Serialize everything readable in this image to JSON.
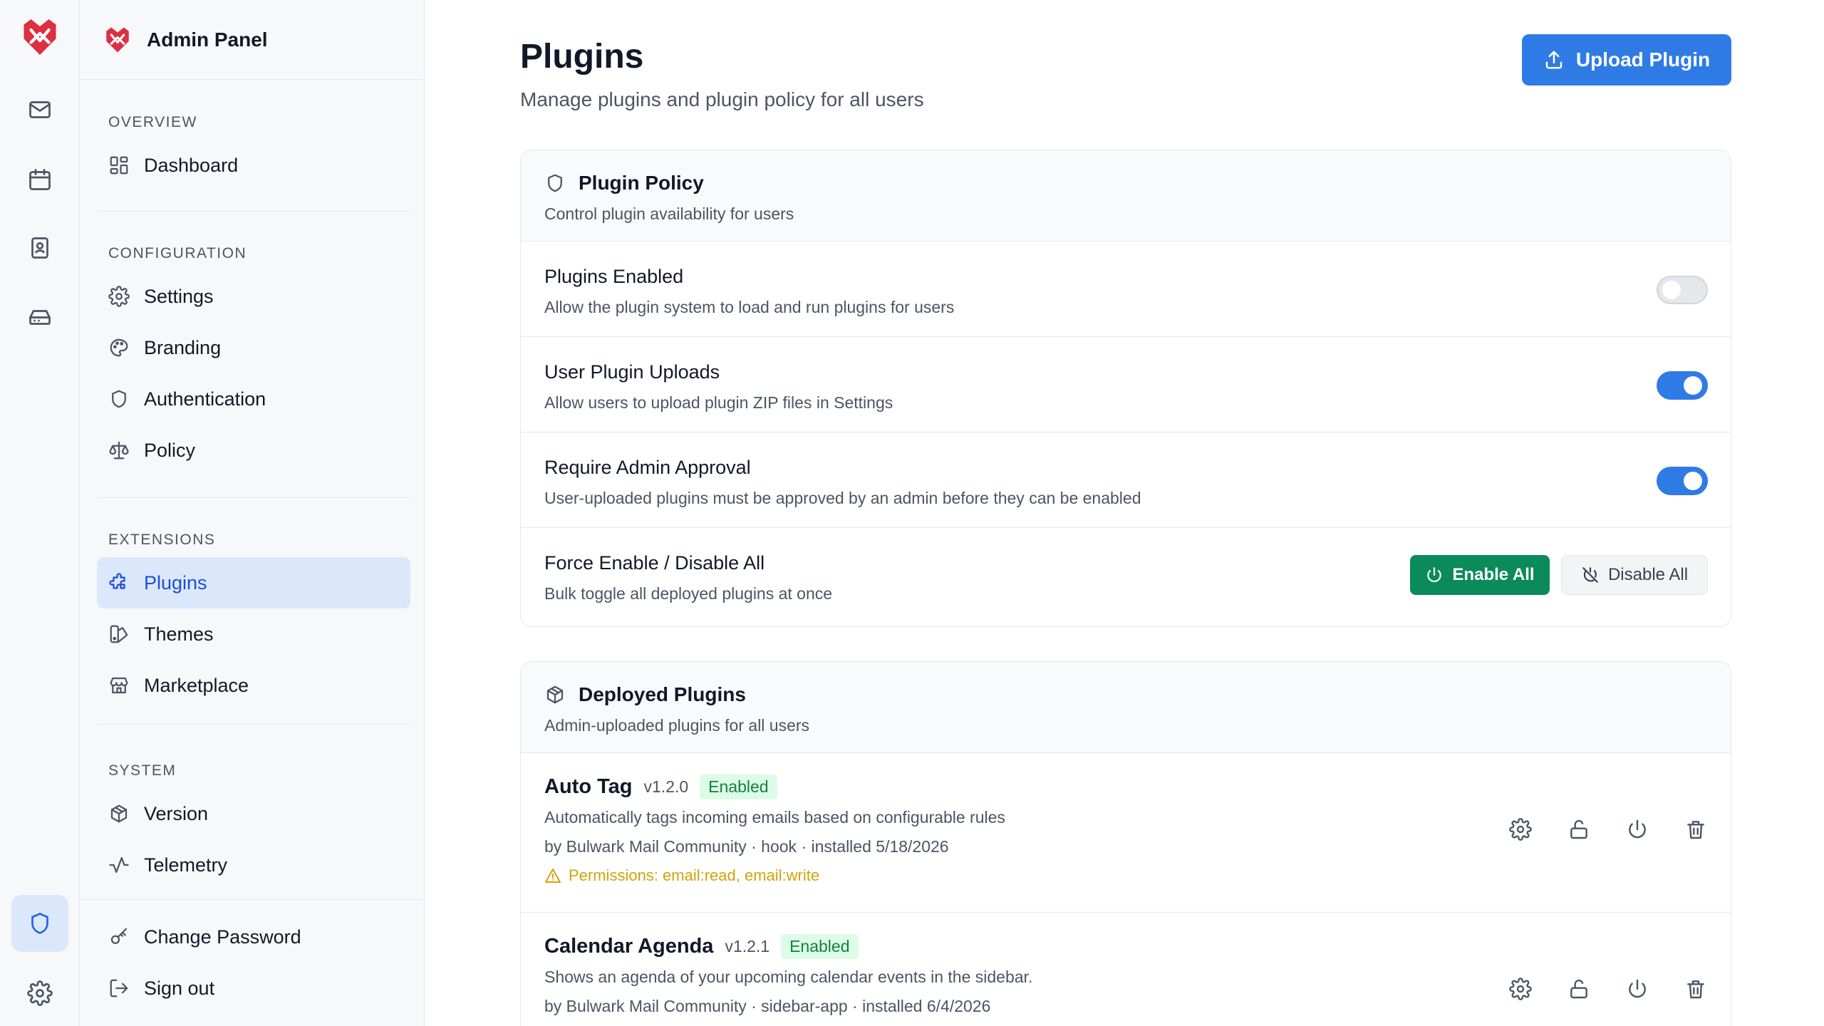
{
  "colors": {
    "accent": "#2f7be6",
    "success": "#0b8a5c",
    "warning": "#d4a20a",
    "active_bg": "#dbe7fb"
  },
  "rail": {
    "items": [
      {
        "icon": "mail-icon"
      },
      {
        "icon": "calendar-icon"
      },
      {
        "icon": "contacts-icon"
      },
      {
        "icon": "drive-icon"
      }
    ],
    "bottom": [
      {
        "icon": "shield-icon",
        "active": true
      },
      {
        "icon": "gear-icon"
      }
    ]
  },
  "sidebar": {
    "title": "Admin Panel",
    "sections": [
      {
        "label": "OVERVIEW",
        "items": [
          {
            "label": "Dashboard",
            "icon": "dashboard-icon"
          }
        ]
      },
      {
        "label": "CONFIGURATION",
        "items": [
          {
            "label": "Settings",
            "icon": "gear-icon"
          },
          {
            "label": "Branding",
            "icon": "palette-icon"
          },
          {
            "label": "Authentication",
            "icon": "shield-icon"
          },
          {
            "label": "Policy",
            "icon": "scale-icon"
          }
        ]
      },
      {
        "label": "EXTENSIONS",
        "items": [
          {
            "label": "Plugins",
            "icon": "puzzle-icon",
            "active": true
          },
          {
            "label": "Themes",
            "icon": "swatch-icon"
          },
          {
            "label": "Marketplace",
            "icon": "store-icon"
          }
        ]
      },
      {
        "label": "SYSTEM",
        "items": [
          {
            "label": "Version",
            "icon": "package-icon"
          },
          {
            "label": "Telemetry",
            "icon": "activity-icon"
          }
        ]
      }
    ],
    "footer": [
      {
        "label": "Change Password",
        "icon": "key-icon"
      },
      {
        "label": "Sign out",
        "icon": "sign-out-icon"
      }
    ]
  },
  "header": {
    "title": "Plugins",
    "subtitle": "Manage plugins and plugin policy for all users",
    "upload_label": "Upload Plugin"
  },
  "policy": {
    "title": "Plugin Policy",
    "subtitle": "Control plugin availability for users",
    "rows": [
      {
        "title": "Plugins Enabled",
        "desc": "Allow the plugin system to load and run plugins for users",
        "on": false
      },
      {
        "title": "User Plugin Uploads",
        "desc": "Allow users to upload plugin ZIP files in Settings",
        "on": true
      },
      {
        "title": "Require Admin Approval",
        "desc": "User-uploaded plugins must be approved by an admin before they can be enabled",
        "on": true
      }
    ],
    "bulk": {
      "title": "Force Enable / Disable All",
      "desc": "Bulk toggle all deployed plugins at once",
      "enable_label": "Enable All",
      "disable_label": "Disable All"
    }
  },
  "deployed": {
    "title": "Deployed Plugins",
    "subtitle": "Admin-uploaded plugins for all users",
    "plugins": [
      {
        "name": "Auto Tag",
        "version": "v1.2.0",
        "status": "Enabled",
        "desc": "Automatically tags incoming emails based on configurable rules",
        "meta": "by Bulwark Mail Community · hook · installed 5/18/2026",
        "permissions": "Permissions: email:read, email:write"
      },
      {
        "name": "Calendar Agenda",
        "version": "v1.2.1",
        "status": "Enabled",
        "desc": "Shows an agenda of your upcoming calendar events in the sidebar.",
        "meta": "by Bulwark Mail Community · sidebar-app · installed 6/4/2026",
        "permissions": ""
      }
    ]
  }
}
